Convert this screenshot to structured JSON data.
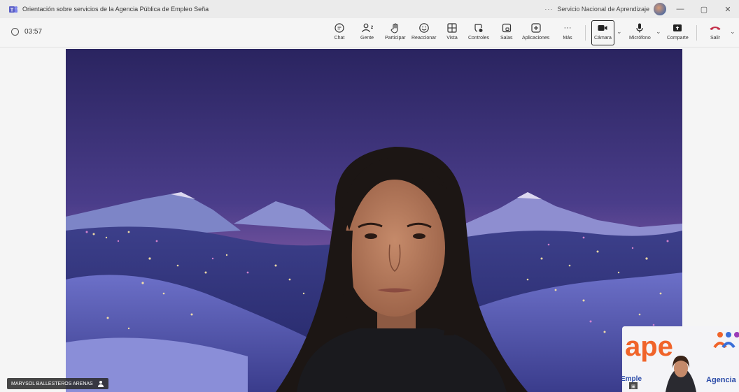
{
  "window": {
    "title": "Orientación sobre servicios de la Agencia Pública de Empleo Seña",
    "more": "···",
    "org": "Servicio Nacional de Aprendizaje",
    "minimize": "—",
    "restore": "▢",
    "close": "✕"
  },
  "meeting": {
    "timer": "03:57"
  },
  "toolbar": {
    "chat": "Chat",
    "people": "Gente",
    "people_count": "2",
    "raise_hand": "Participar",
    "react": "Reaccionar",
    "view": "Vista",
    "controls": "Controles",
    "rooms": "Salas",
    "apps": "Aplicaciones",
    "more": "Más",
    "more_icon": "···",
    "camera": "Cámara",
    "mic": "Micrófono",
    "share": "Comparte",
    "leave": "Salir",
    "chevron": "⌄"
  },
  "stage": {
    "participant_name": "MARYSOL BALLESTEROS ARENAS"
  },
  "pip": {
    "logo_text": "ape",
    "slide_text_left": "Emple",
    "slide_text_right": "Agencia",
    "small_icon": "▣"
  },
  "colors": {
    "accent": "#5b5fc7",
    "leave": "#c4314b",
    "titlebar_bg": "#ebebeb",
    "toolbar_bg": "#f5f5f5"
  }
}
